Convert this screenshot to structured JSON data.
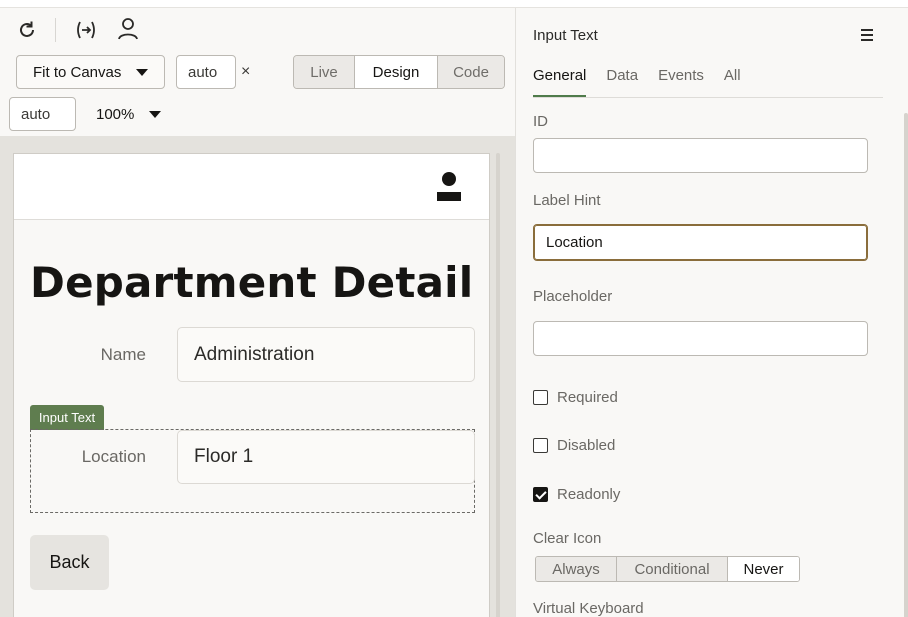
{
  "toolbar": {
    "refresh_icon": "refresh-icon",
    "expression_icon": "expression-icon",
    "user_icon": "user-icon",
    "fit_label": "Fit to Canvas",
    "width_value": "auto",
    "width_clear": "×",
    "height_value": "auto",
    "zoom": "100%",
    "modes": [
      "Live",
      "Design",
      "Code"
    ],
    "selected_mode": "Design"
  },
  "canvas": {
    "page_title": "Department Detail",
    "name_label": "Name",
    "name_value": "Administration",
    "selected_tag": "Input Text",
    "location_label": "Location",
    "location_value": "Floor 1",
    "back_label": "Back"
  },
  "inspector": {
    "title": "Input Text",
    "tabs": [
      "General",
      "Data",
      "Events",
      "All"
    ],
    "active_tab": "General",
    "id_label": "ID",
    "id_value": "",
    "label_hint_label": "Label Hint",
    "label_hint_value": "Location",
    "placeholder_label": "Placeholder",
    "placeholder_value": "",
    "required_label": "Required",
    "required": false,
    "disabled_label": "Disabled",
    "disabled": false,
    "readonly_label": "Readonly",
    "readonly": true,
    "clear_icon_label": "Clear Icon",
    "clear_icon_options": [
      "Always",
      "Conditional",
      "Never"
    ],
    "clear_icon_selected": "Never",
    "virtual_keyboard_label": "Virtual Keyboard"
  },
  "colors": {
    "accent_green": "#5f7d4f",
    "focus_border": "#8a6d3b"
  }
}
